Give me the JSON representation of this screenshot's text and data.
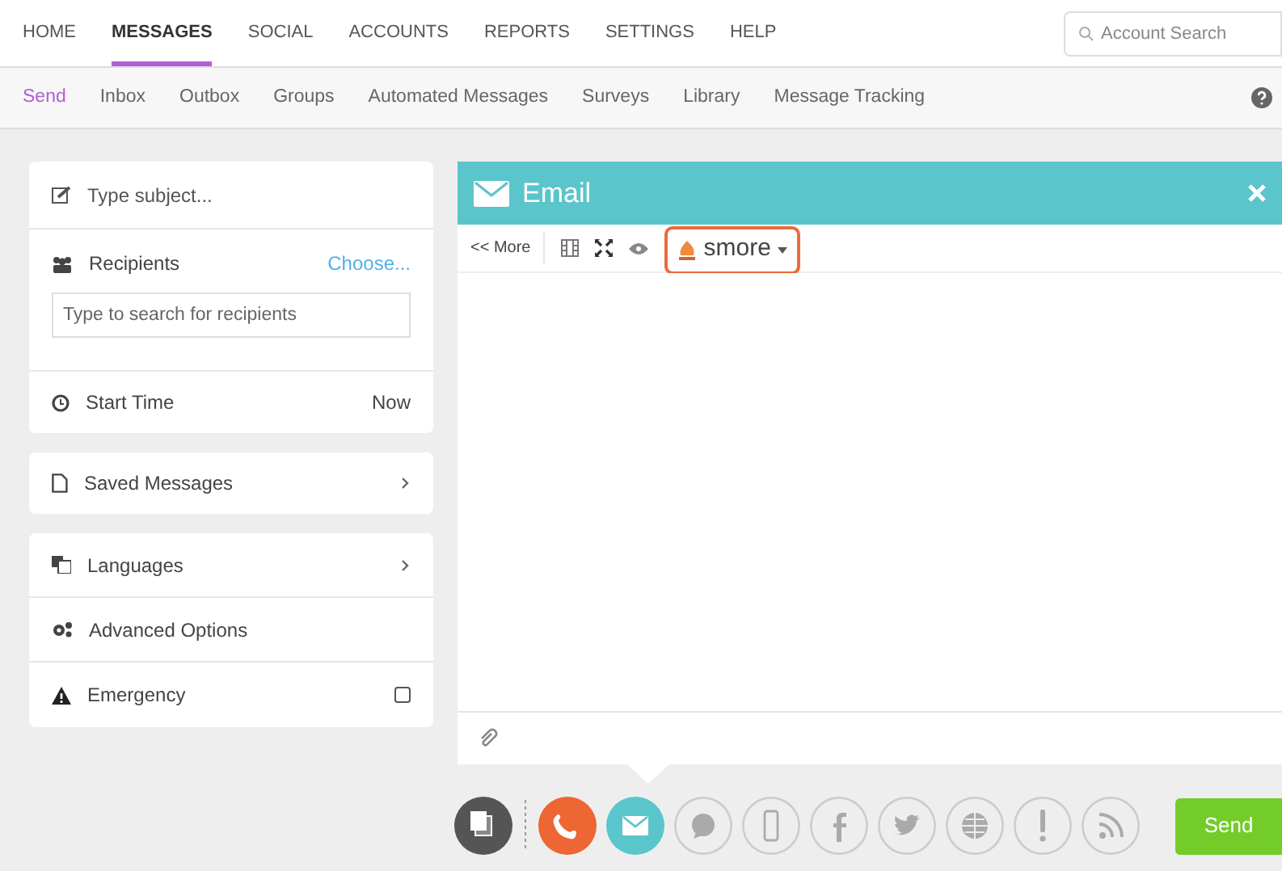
{
  "top_nav": [
    {
      "label": "HOME",
      "selected": false
    },
    {
      "label": "MESSAGES",
      "selected": true
    },
    {
      "label": "SOCIAL",
      "selected": false
    },
    {
      "label": "ACCOUNTS",
      "selected": false
    },
    {
      "label": "REPORTS",
      "selected": false
    },
    {
      "label": "SETTINGS",
      "selected": false
    },
    {
      "label": "HELP",
      "selected": false
    }
  ],
  "account_search": {
    "placeholder": "Account Search"
  },
  "sub_nav": [
    {
      "label": "Send",
      "selected": true
    },
    {
      "label": "Inbox",
      "selected": false
    },
    {
      "label": "Outbox",
      "selected": false
    },
    {
      "label": "Groups",
      "selected": false
    },
    {
      "label": "Automated Messages",
      "selected": false
    },
    {
      "label": "Surveys",
      "selected": false
    },
    {
      "label": "Library",
      "selected": false
    },
    {
      "label": "Message Tracking",
      "selected": false
    }
  ],
  "compose": {
    "subject_placeholder": "Type subject...",
    "recipients_label": "Recipients",
    "choose_link": "Choose...",
    "recipients_placeholder": "Type to search for recipients",
    "start_time_label": "Start Time",
    "start_time_value": "Now"
  },
  "saved_messages": "Saved Messages",
  "options": [
    {
      "kind": "link",
      "label": "Languages"
    },
    {
      "kind": "plain",
      "label": "Advanced Options"
    },
    {
      "kind": "checkbox",
      "label": "Emergency",
      "checked": false
    }
  ],
  "email_panel": {
    "title": "Email",
    "more_button": "<< More",
    "smore_button": "smore"
  },
  "channels": [
    {
      "kind": "phone",
      "on": true,
      "color": "#ee6633"
    },
    {
      "kind": "email",
      "on": true,
      "color": "#5bc5cc"
    },
    {
      "kind": "sms",
      "on": false
    },
    {
      "kind": "mobile",
      "on": false
    },
    {
      "kind": "facebook",
      "on": false
    },
    {
      "kind": "twitter",
      "on": false
    },
    {
      "kind": "web",
      "on": false
    },
    {
      "kind": "alert",
      "on": false
    },
    {
      "kind": "rss",
      "on": false
    }
  ],
  "send_button": "Send"
}
